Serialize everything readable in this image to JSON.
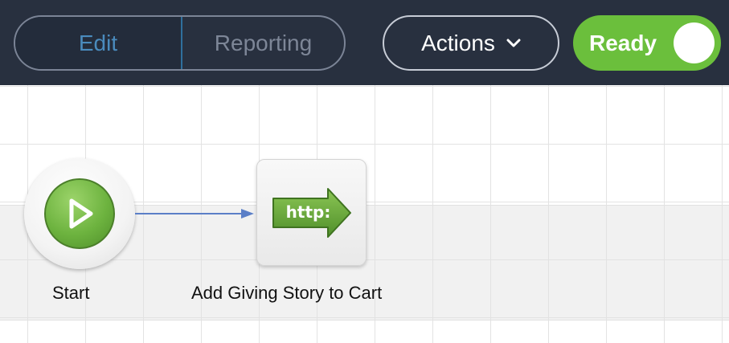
{
  "toolbar": {
    "tabs": [
      {
        "label": "Edit",
        "active": true
      },
      {
        "label": "Reporting",
        "active": false
      }
    ],
    "actions_label": "Actions",
    "ready_label": "Ready",
    "ready_on": true
  },
  "canvas": {
    "nodes": [
      {
        "id": "start",
        "label": "Start",
        "icon": "play-icon"
      },
      {
        "id": "http",
        "label": "Add Giving Story to Cart",
        "icon": "http-arrow-icon",
        "icon_text": "http:"
      }
    ]
  },
  "colors": {
    "toolbar_bg": "#28303f",
    "active_tab_text": "#4a8bbd",
    "ready_green": "#6bbf3c",
    "connector_blue": "#5b7fc7"
  }
}
